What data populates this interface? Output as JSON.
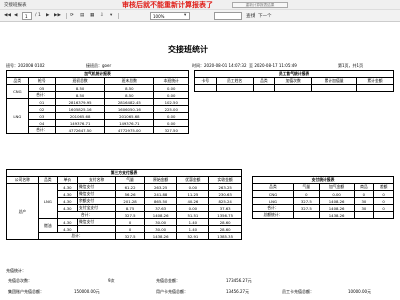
{
  "app": {
    "tab_title": "交接班报表"
  },
  "banner": {
    "warning": "审核后就不能重新计算报表了",
    "recalc_button": "重新计算报表结果"
  },
  "toolbar": {
    "page_current": "1",
    "page_total_label": "/ 1",
    "zoom": "100%",
    "find_placeholder": "",
    "find_label": "查找",
    "next_label": "下一个"
  },
  "report": {
    "title": "交接班统计",
    "meta": {
      "site_label": "班号：",
      "site_value": "202008 0102",
      "shift_label": "接班员：",
      "shift_value": "goer",
      "time_label": "时间：",
      "time_value": "2020-08-01 14:07:32",
      "to_label": "至",
      "to_value": "2020-08-17 11:05:49",
      "page_label": "第1页，共1页"
    },
    "gun_table": {
      "caption": "加气机统计报表",
      "headers": [
        "品类",
        "枪号",
        "班初总数",
        "班末总数",
        "本班统计"
      ],
      "rows": [
        [
          "CNG",
          "05",
          "8.50",
          "8.50",
          "0.00"
        ],
        [
          "",
          "合计：",
          "8.50",
          "8.50",
          "0.00"
        ],
        [
          "LNG",
          "01",
          "2816379.95",
          "2816482.45",
          "102.50"
        ],
        [
          "",
          "02",
          "1605825.16",
          "1606050.16",
          "225.00"
        ],
        [
          "",
          "03",
          "201065.68",
          "201065.68",
          "0.00"
        ],
        [
          "",
          "04",
          "149376.71",
          "149376.71",
          "0.00"
        ],
        [
          "",
          "合计：",
          "4772647.50",
          "4772975.00",
          "327.50"
        ]
      ]
    },
    "card_table": {
      "caption": "员工售气统计报表",
      "headers": [
        "卡号",
        "员工姓名",
        "品类",
        "加值次数",
        "累计加值量",
        "累计金额"
      ]
    },
    "pay_table": {
      "caption": "第三方支付报表",
      "headers": [
        "公司名称",
        "品类",
        "单价",
        "支付名称",
        "气量",
        "原始金额",
        "优惠金额",
        "实收金额"
      ],
      "company": "总产",
      "rows": [
        [
          "",
          "4.30",
          "微信支付",
          "61.22",
          "263.25",
          "0.00",
          "263.25"
        ],
        [
          "LNG",
          "4.30",
          "微信支付",
          "56.26",
          "241.88",
          "11.25",
          "230.63"
        ],
        [
          "",
          "4.30",
          "余额支付",
          "201.28",
          "865.50",
          "40.26",
          "825.24"
        ],
        [
          "",
          "4.30",
          "支付宝支付",
          "8.75",
          "37.63",
          "0.00",
          "37.63"
        ],
        [
          "",
          "合计：",
          "",
          "327.5",
          "1408.26",
          "51.51",
          "1356.75"
        ],
        [
          "",
          "4.30",
          "微信支付",
          "0",
          "30.00",
          "1.40",
          "28.60"
        ],
        [
          "燃油",
          "4.30",
          "",
          "0",
          "30.00",
          "1.40",
          "28.60"
        ],
        [
          "",
          "总计：",
          "",
          "327.5",
          "1438.26",
          "52.91",
          "1385.35"
        ]
      ]
    },
    "summary_table": {
      "caption": "支付统计报表",
      "headers": [
        "品类",
        "气量",
        "加气金额",
        "商品",
        "差额"
      ],
      "rows": [
        [
          "CNG",
          "0",
          "0.00",
          "0",
          "0"
        ],
        [
          "LNG",
          "327.5",
          "1408.26",
          "30",
          "0"
        ],
        [
          "合计：",
          "327.5",
          "1408.26",
          "30",
          "0"
        ],
        [
          "总额统计：",
          "",
          "1438.26",
          "",
          ""
        ]
      ]
    },
    "footer": {
      "title": "充值统计：",
      "count_label": "充值总次数：",
      "count_value": "9次",
      "total_label": "充值总金额：",
      "total_value": "173456.27元",
      "offset_label": "集团账户充值总额：",
      "offset_value": "150000.00元",
      "user_label": "用户卡充值总额：",
      "user_value": "13456.27元",
      "staff_label": "员工卡充值总额：",
      "staff_value": "10000.00元"
    }
  }
}
